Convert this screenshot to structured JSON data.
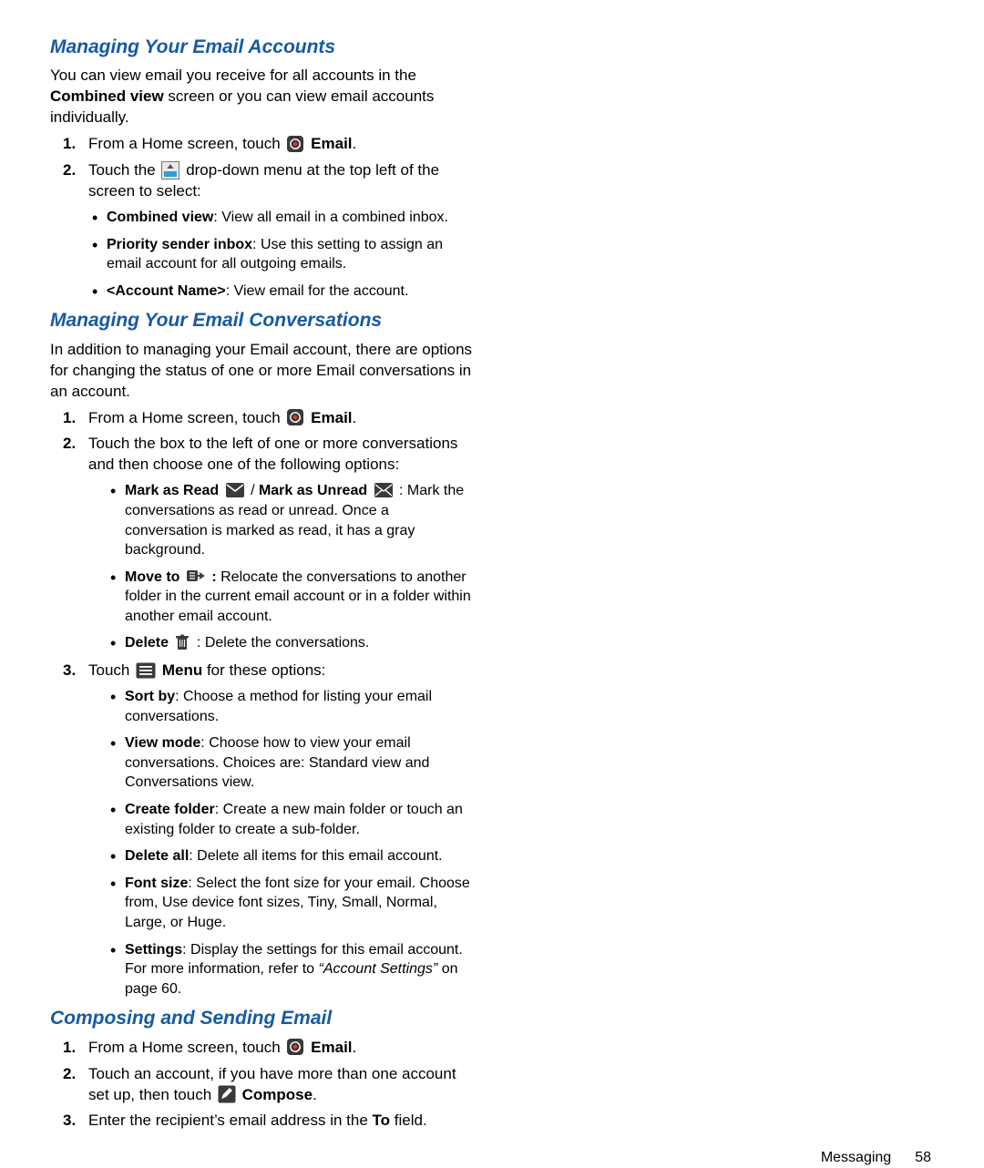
{
  "sections": {
    "s1": {
      "title": "Managing Your Email Accounts",
      "intro_a": "You can view email you receive for all accounts in the ",
      "intro_b": "Combined view",
      "intro_c": " screen or you can view email accounts individually.",
      "step1a": "From a Home screen, touch ",
      "step1b": "Email",
      "step1c": ".",
      "step2a": "Touch the ",
      "step2b": " drop-down menu at the top left of the screen to select:",
      "b1a": "Combined view",
      "b1b": ": View all email in a combined inbox.",
      "b2a": "Priority sender inbox",
      "b2b": ": Use this setting to assign an email account for all outgoing emails.",
      "b3a": "<Account Name>",
      "b3b": ": View email for the account."
    },
    "s2": {
      "title": "Managing Your Email Conversations",
      "intro": "In addition to managing your Email account, there are options for changing the status of one or more Email conversations in an account.",
      "step1a": "From a Home screen, touch ",
      "step1b": "Email",
      "step1c": ".",
      "step2": "Touch the box to the left of one or more conversations and then choose one of the following options:",
      "b1a": "Mark as Read ",
      "b1b": " / ",
      "b1c": "Mark as Unread ",
      "b1d": " : Mark the conversations as read or unread. Once a conversation is marked as read, it has a gray background.",
      "b2a": "Move to ",
      "b2b": " : ",
      "b2c": "Relocate the conversations to another folder in the current email account or in a folder within another email account.",
      "b3a": "Delete ",
      "b3b": " : Delete the conversations.",
      "step3a": "Touch ",
      "step3b": "Menu",
      "step3c": " for these options:",
      "c1a": "Sort by",
      "c1b": ": Choose a method for listing your email conversations.",
      "c2a": "View mode",
      "c2b": ": Choose how to view your email conversations. Choices are: Standard view and Conversations view.",
      "c3a": "Create folder",
      "c3b": ": Create a new main folder or touch an existing folder to create a sub-folder.",
      "c4a": "Delete all",
      "c4b": ": Delete all items for this email account.",
      "c5a": "Font size",
      "c5b": ": Select the font size for your email. Choose from, Use device font sizes, Tiny, Small, Normal, Large, or Huge.",
      "c6a": "Settings",
      "c6b": ": Display the settings for this email account. For more information, refer to ",
      "c6c": "“Account Settings”",
      "c6d": " on page 60."
    },
    "s3": {
      "title": "Composing and Sending Email",
      "step1a": "From a Home screen, touch ",
      "step1b": "Email",
      "step1c": ".",
      "step2a": "Touch an account, if you have more than one account set up, then touch ",
      "step2b": "Compose",
      "step2c": ".",
      "step3a": "Enter the recipient’s email address in the ",
      "step3b": "To",
      "step3c": " field."
    }
  },
  "numbers": {
    "n1": "1.",
    "n2": "2.",
    "n3": "3."
  },
  "footer": {
    "label": "Messaging",
    "page": "58"
  }
}
